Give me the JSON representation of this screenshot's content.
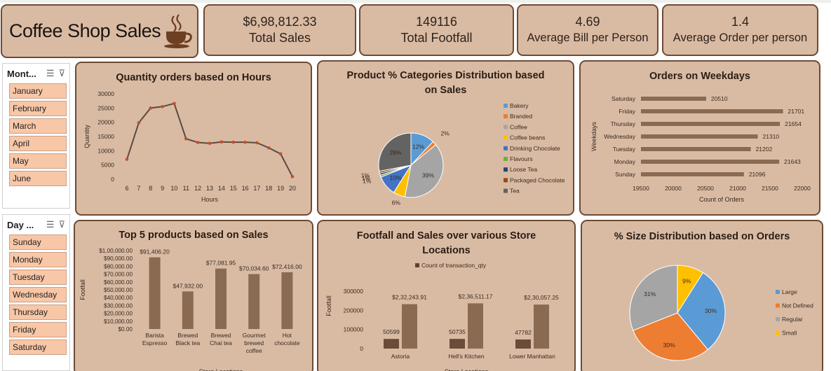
{
  "title": "Coffee Shop Sales",
  "kpis": [
    {
      "value": "$6,98,812.33",
      "label": "Total Sales"
    },
    {
      "value": "149116",
      "label": "Total Footfall"
    },
    {
      "value": "4.69",
      "label": "Average Bill per Person"
    },
    {
      "value": "1.4",
      "label": "Average Order per person"
    }
  ],
  "slicers": {
    "month": {
      "header": "Mont...",
      "items": [
        "January",
        "February",
        "March",
        "April",
        "May",
        "June"
      ]
    },
    "day": {
      "header": "Day ...",
      "items": [
        "Sunday",
        "Monday",
        "Tuesday",
        "Wednesday",
        "Thursday",
        "Friday",
        "Saturday"
      ]
    }
  },
  "colors": {
    "accent": "#8b6a52",
    "panel": "#d9bba4",
    "border": "#6e4a34",
    "line": "#5a4a40",
    "marker": "#c0502a"
  },
  "chart_data": [
    {
      "type": "line",
      "title": "Quantity orders based on Hours",
      "xlabel": "Hours",
      "ylabel": "Quantity",
      "x": [
        6,
        7,
        8,
        9,
        10,
        11,
        12,
        13,
        14,
        15,
        16,
        17,
        18,
        19,
        20
      ],
      "values": [
        7000,
        19800,
        25000,
        25500,
        26600,
        14200,
        12900,
        12600,
        13100,
        13000,
        13000,
        12800,
        11000,
        8900,
        900
      ],
      "yticks": [
        "0",
        "5000",
        "10000",
        "15000",
        "20000",
        "25000",
        "30000"
      ],
      "ylim": [
        0,
        30000
      ]
    },
    {
      "type": "pie",
      "title": "Product % Categories Distribution based on Sales",
      "categories": [
        "Bakery",
        "Branded",
        "Coffee",
        "Coffee beans",
        "Drinking Chocolate",
        "Flavours",
        "Loose Tea",
        "Packaged Chocolate",
        "Tea"
      ],
      "values": [
        12,
        2,
        39,
        6,
        10,
        1,
        1,
        1,
        28
      ],
      "labels": [
        "12%",
        "2%",
        "39%",
        "6%",
        "10%",
        "1%",
        "1%",
        "1%",
        "28%"
      ],
      "colors": [
        "#5b9bd5",
        "#ed7d31",
        "#a5a5a5",
        "#ffc000",
        "#4472c4",
        "#70ad47",
        "#264478",
        "#9e480e",
        "#636363"
      ]
    },
    {
      "type": "bar",
      "title": "Orders on Weekdays",
      "xlabel": "Count of Orders",
      "ylabel": "Weekdays",
      "categories": [
        "Saturday",
        "Friday",
        "Thursday",
        "Wednesday",
        "Tuesday",
        "Monday",
        "Sunday"
      ],
      "values": [
        20510,
        21701,
        21654,
        21310,
        21202,
        21643,
        21096
      ],
      "xticks": [
        "19500",
        "20000",
        "20500",
        "21000",
        "21500",
        "22000"
      ],
      "xlim": [
        19500,
        22000
      ]
    },
    {
      "type": "bar",
      "title": "Top 5 products based on Sales",
      "ylabel": "Footfall",
      "xlabel": "Store Locations",
      "categories": [
        "Barista Espresso",
        "Brewed Black tea",
        "Brewed Chai tea",
        "Gourmet brewed coffee",
        "Hot chocolate"
      ],
      "category_lines": [
        [
          "Barista",
          "Espresso"
        ],
        [
          "Brewed",
          "Black tea"
        ],
        [
          "Brewed",
          "Chai tea"
        ],
        [
          "Gourmet",
          "brewed",
          "coffee"
        ],
        [
          "Hot",
          "chocolate"
        ]
      ],
      "values": [
        91406.2,
        47932.0,
        77081.95,
        70034.6,
        72416.0
      ],
      "labels": [
        "$91,406.20",
        "$47,932.00",
        "$77,081.95",
        "$70,034.60",
        "$72,416.00"
      ],
      "yticks": [
        "$0.00",
        "$10,000.00",
        "$20,000.00",
        "$30,000.00",
        "$40,000.00",
        "$50,000.00",
        "$60,000.00",
        "$70,000.00",
        "$80,000.00",
        "$90,000.00",
        "$1,00,000.00"
      ],
      "ylim": [
        0,
        100000
      ]
    },
    {
      "type": "bar",
      "title": "Footfall and Sales over various Store Locations",
      "ylabel": "Footfall",
      "xlabel": "Store Locations",
      "legend": "Count of transaction_qty",
      "categories": [
        "Astoria",
        "Hell's Kitchen",
        "Lower Manhattan"
      ],
      "series": [
        {
          "name": "Count of transaction_qty",
          "values": [
            50599,
            50735,
            47782
          ],
          "labels": [
            "50599",
            "50735",
            "47782"
          ]
        },
        {
          "values": [
            232243.91,
            236511.17,
            230057.25
          ],
          "labels": [
            "$2,32,243.91",
            "$2,36,511.17",
            "$2,30,057.25"
          ]
        }
      ],
      "yticks": [
        "0",
        "100000",
        "200000",
        "300000"
      ],
      "ylim": [
        0,
        300000
      ]
    },
    {
      "type": "pie",
      "title": "% Size Distribution based on Orders",
      "categories": [
        "Large",
        "Not Defined",
        "Regular",
        "Small"
      ],
      "values": [
        30,
        30,
        31,
        9
      ],
      "labels": [
        "30%",
        "30%",
        "31%",
        "9%"
      ],
      "colors": [
        "#5b9bd5",
        "#ed7d31",
        "#a5a5a5",
        "#ffc000"
      ]
    }
  ]
}
